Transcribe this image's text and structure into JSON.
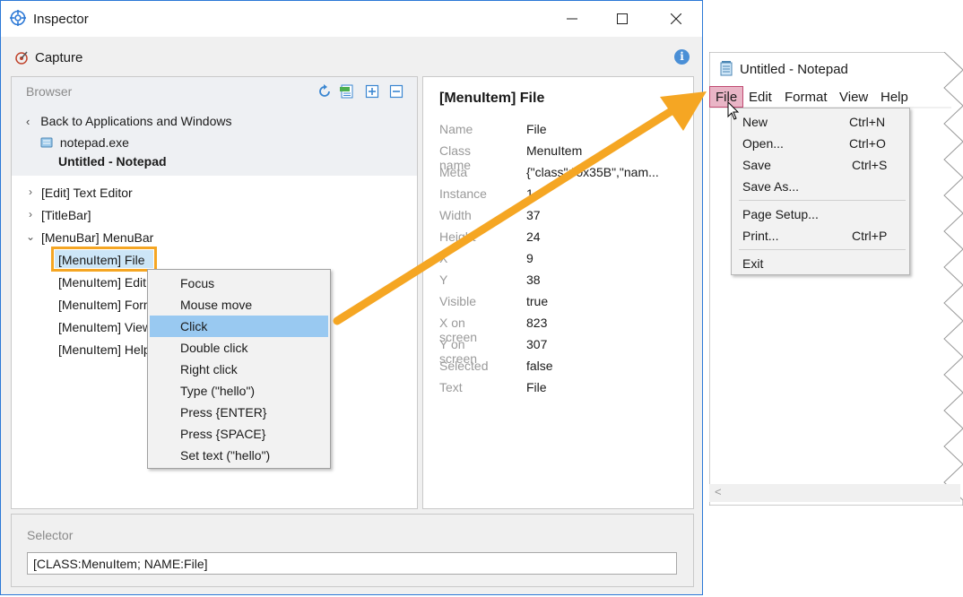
{
  "inspector": {
    "title": "Inspector",
    "capture_label": "Capture",
    "info_icon": "i",
    "browser": {
      "title": "Browser",
      "back_label": "Back to Applications and Windows",
      "exe_label": "notepad.exe",
      "window_label": "Untitled - Notepad",
      "tree": [
        {
          "label": "[Edit] Text Editor",
          "expander": "›"
        },
        {
          "label": "[TitleBar]",
          "expander": "›"
        },
        {
          "label": "[MenuBar] MenuBar",
          "expander": "⌄"
        }
      ],
      "children": [
        {
          "label": "[MenuItem] File"
        },
        {
          "label": "[MenuItem] Edit"
        },
        {
          "label": "[MenuItem] Format"
        },
        {
          "label": "[MenuItem] View"
        },
        {
          "label": "[MenuItem] Help"
        }
      ]
    },
    "context_menu": {
      "items": [
        "Focus",
        "Mouse move",
        "Click",
        "Double click",
        "Right click",
        "Type (\"hello\")",
        "Press {ENTER}",
        "Press {SPACE}",
        "Set text (\"hello\")"
      ],
      "highlighted_index": 2
    },
    "properties": {
      "title": "[MenuItem] File",
      "rows": [
        {
          "key": "Name",
          "value": "File"
        },
        {
          "key": "Class name",
          "value": "MenuItem"
        },
        {
          "key": "Meta",
          "value": "{\"class\":\"0x35B\",\"nam..."
        },
        {
          "key": "Instance",
          "value": "1"
        },
        {
          "key": "Width",
          "value": "37"
        },
        {
          "key": "Height",
          "value": "24"
        },
        {
          "key": "X",
          "value": "9"
        },
        {
          "key": "Y",
          "value": "38"
        },
        {
          "key": "Visible",
          "value": "true"
        },
        {
          "key": "X on screen",
          "value": "823"
        },
        {
          "key": "Y on screen",
          "value": "307"
        },
        {
          "key": "Selected",
          "value": "false"
        },
        {
          "key": "Text",
          "value": "File"
        }
      ]
    },
    "selector": {
      "label": "Selector",
      "value": "[CLASS:MenuItem; NAME:File]"
    }
  },
  "notepad": {
    "title": "Untitled - Notepad",
    "menu": [
      "File",
      "Edit",
      "Format",
      "View",
      "Help"
    ],
    "file_menu": [
      {
        "label": "New",
        "shortcut": "Ctrl+N"
      },
      {
        "label": "Open...",
        "shortcut": "Ctrl+O"
      },
      {
        "label": "Save",
        "shortcut": "Ctrl+S"
      },
      {
        "label": "Save As...",
        "shortcut": ""
      },
      {
        "label": "Page Setup...",
        "shortcut": ""
      },
      {
        "label": "Print...",
        "shortcut": "Ctrl+P"
      },
      {
        "label": "Exit",
        "shortcut": ""
      }
    ],
    "scroll_left": "<"
  },
  "colors": {
    "accent_arrow": "#f5a623",
    "selection_border": "#f5a623",
    "menu_highlight": "#99c9f1",
    "tree_selection": "#cde6f7",
    "notepad_file_highlight": "#e9b5c6"
  }
}
